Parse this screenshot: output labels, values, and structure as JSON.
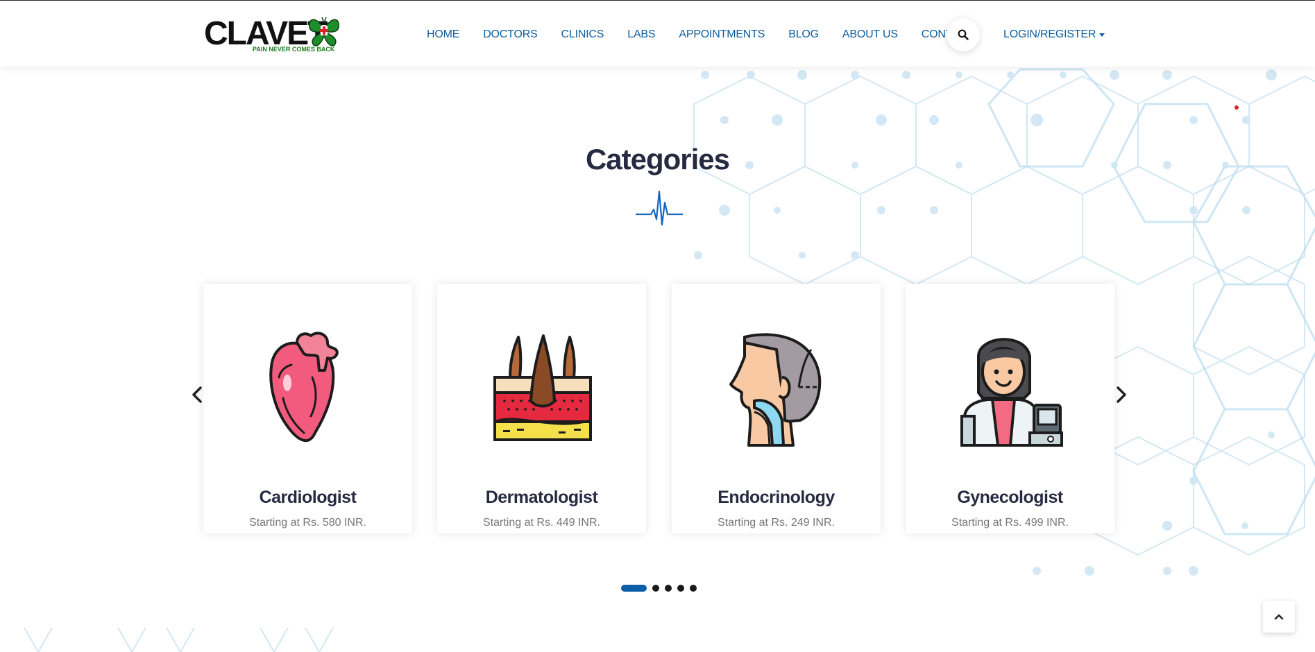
{
  "brand": {
    "name": "CLAVET",
    "tagline": "PAIN NEVER COMES BACK"
  },
  "nav": {
    "items": [
      {
        "label": "HOME"
      },
      {
        "label": "DOCTORS"
      },
      {
        "label": "CLINICS"
      },
      {
        "label": "LABS"
      },
      {
        "label": "APPOINTMENTS"
      },
      {
        "label": "BLOG"
      },
      {
        "label": "ABOUT US"
      },
      {
        "label": "CONTACT"
      }
    ],
    "login_label": "LOGIN/REGISTER"
  },
  "section": {
    "title": "Categories"
  },
  "categories": [
    {
      "name": "Cardiologist",
      "price": "Starting at Rs. 580 INR.",
      "icon": "heart-icon"
    },
    {
      "name": "Dermatologist",
      "price": "Starting at Rs. 449 INR.",
      "icon": "skin-layers-icon"
    },
    {
      "name": "Endocrinology",
      "price": "Starting at Rs. 249 INR.",
      "icon": "head-throat-icon"
    },
    {
      "name": "Gynecologist",
      "price": "Starting at Rs. 499 INR.",
      "icon": "doctor-ultrasound-icon"
    }
  ],
  "carousel": {
    "page_count": 5,
    "active_page": 1
  },
  "colors": {
    "nav_link": "#0b5d9e",
    "title": "#272b41",
    "accent": "#0d5ea8",
    "price_text": "#757575"
  }
}
